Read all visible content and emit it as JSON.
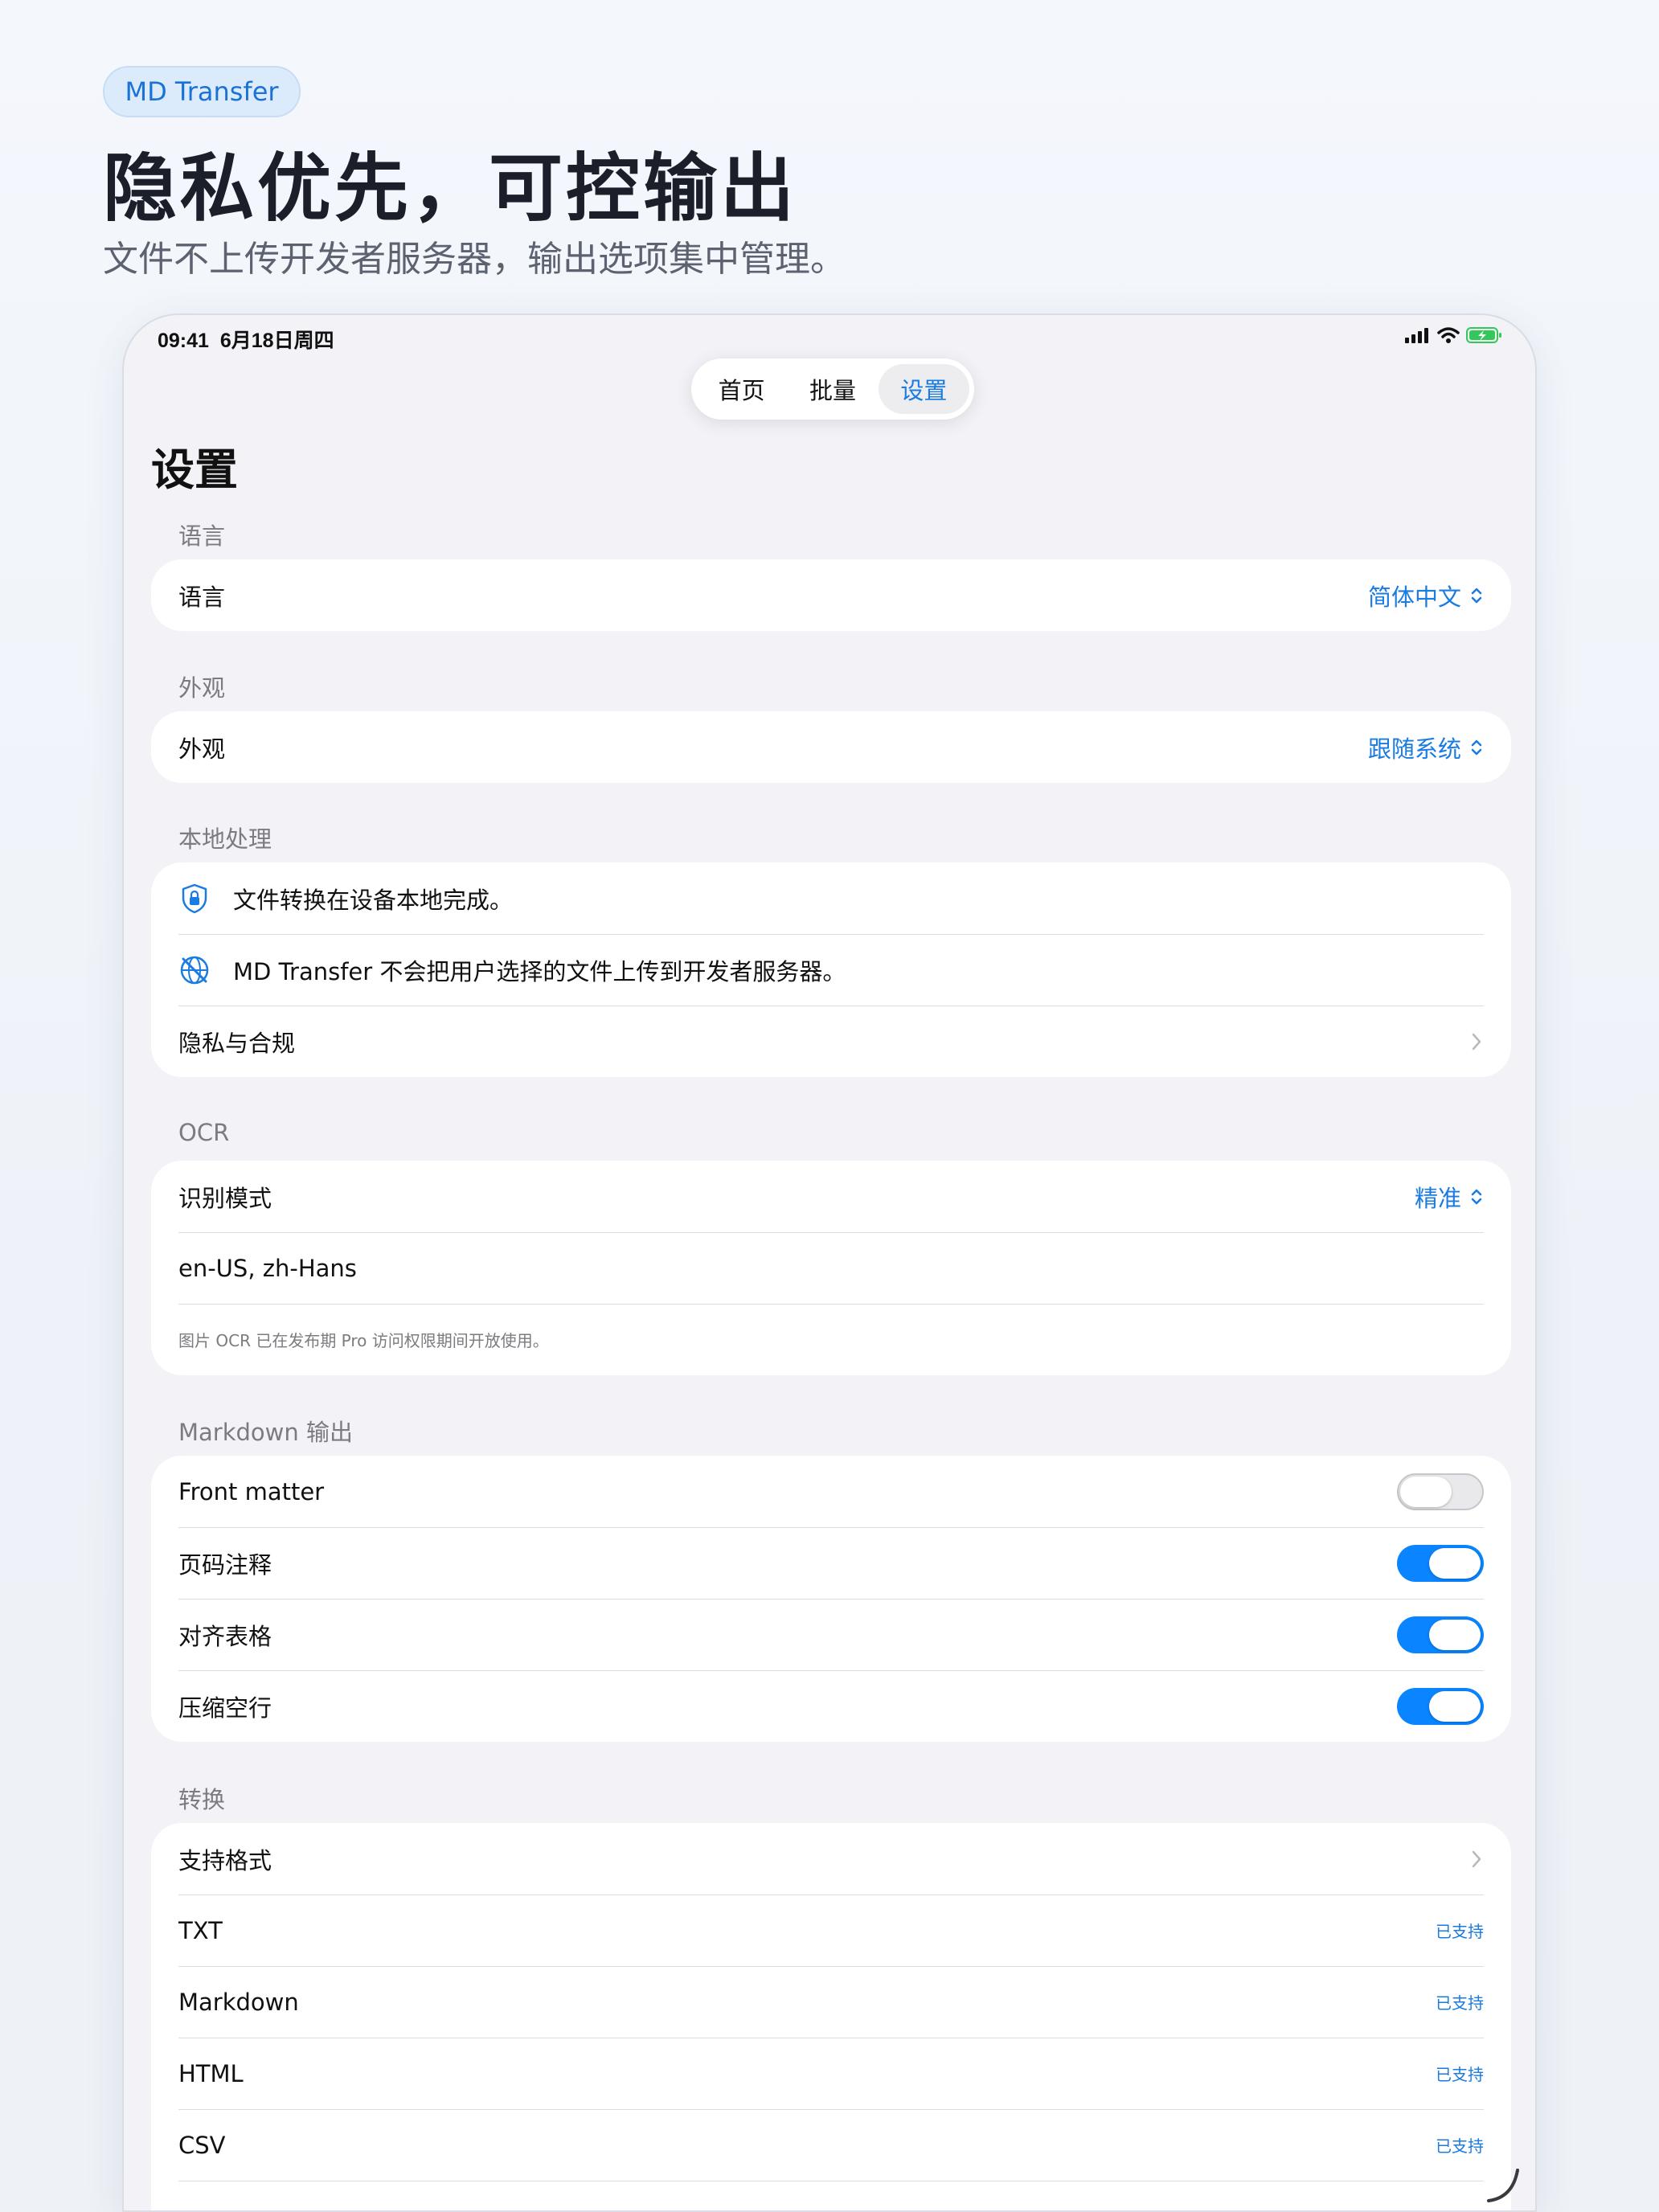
{
  "badge": "MD Transfer",
  "headline": "隐私优先，可控输出",
  "subheadline": "文件不上传开发者服务器，输出选项集中管理。",
  "status_bar": {
    "time": "09:41",
    "date": "6月18日周四"
  },
  "tabs": [
    {
      "label": "首页",
      "active": false
    },
    {
      "label": "批量",
      "active": false
    },
    {
      "label": "设置",
      "active": true
    }
  ],
  "page_title": "设置",
  "language": {
    "header": "语言",
    "label": "语言",
    "value": "简体中文"
  },
  "appearance": {
    "header": "外观",
    "label": "外观",
    "value": "跟随系统"
  },
  "local": {
    "header": "本地处理",
    "items": [
      {
        "icon": "shield-lock-icon",
        "text": "文件转换在设备本地完成。"
      },
      {
        "icon": "globe-slash-icon",
        "text": "MD Transfer 不会把用户选择的文件上传到开发者服务器。"
      }
    ],
    "privacy_link": "隐私与合规"
  },
  "ocr": {
    "header": "OCR",
    "mode_label": "识别模式",
    "mode_value": "精准",
    "languages": "en-US, zh-Hans",
    "footnote": "图片 OCR 已在发布期 Pro 访问权限期间开放使用。"
  },
  "markdown": {
    "header": "Markdown 输出",
    "toggles": [
      {
        "label": "Front matter",
        "on": false
      },
      {
        "label": "页码注释",
        "on": true
      },
      {
        "label": "对齐表格",
        "on": true
      },
      {
        "label": "压缩空行",
        "on": true
      }
    ]
  },
  "conversion": {
    "header": "转换",
    "formats_link": "支持格式",
    "formats": [
      {
        "name": "TXT",
        "status": "已支持"
      },
      {
        "name": "Markdown",
        "status": "已支持"
      },
      {
        "name": "HTML",
        "status": "已支持"
      },
      {
        "name": "CSV",
        "status": "已支持"
      }
    ]
  },
  "colors": {
    "accent": "#1a7be0",
    "toggle_on": "#0a84ff",
    "battery": "#34c759"
  }
}
